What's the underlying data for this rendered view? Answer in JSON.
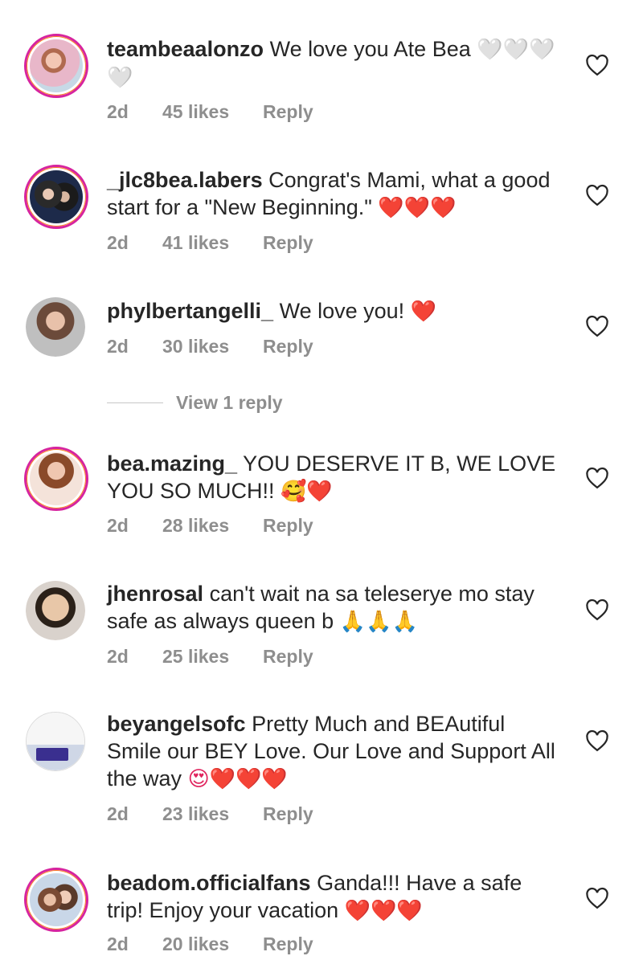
{
  "comments": [
    {
      "username": "teambeaalonzo",
      "text": "We love you Ate Bea",
      "emoji": "🤍🤍🤍🤍",
      "time": "2d",
      "likes": "45 likes",
      "reply": "Reply"
    },
    {
      "username": "_jlc8bea.labers",
      "text": "Congrat's Mami, what a good start for a \"New Beginning.\"",
      "emoji": "❤️❤️❤️",
      "time": "2d",
      "likes": "41 likes",
      "reply": "Reply"
    },
    {
      "username": "phylbertangelli_",
      "text": "We love you!",
      "emoji": "❤️",
      "time": "2d",
      "likes": "30 likes",
      "reply": "Reply"
    },
    {
      "username": "bea.mazing_",
      "text": "YOU DESERVE IT B, WE LOVE YOU SO MUCH!!",
      "emoji": "🥰❤️",
      "time": "2d",
      "likes": "28 likes",
      "reply": "Reply"
    },
    {
      "username": "jhenrosal",
      "text": "can't wait na sa teleserye mo stay safe as always  queen b",
      "emoji": "🙏🙏🙏",
      "time": "2d",
      "likes": "25 likes",
      "reply": "Reply"
    },
    {
      "username": "beyangelsofc",
      "text": "Pretty Much and BEAutiful Smile our BEY Love. Our Love and Support All the way",
      "emoji": "😍❤️❤️❤️",
      "time": "2d",
      "likes": "23 likes",
      "reply": "Reply"
    },
    {
      "username": "beadom.officialfans",
      "text": "Ganda!!! Have a safe trip! Enjoy your vacation",
      "emoji": "❤️❤️❤️",
      "time": "2d",
      "likes": "20 likes",
      "reply": "Reply"
    }
  ],
  "view_replies": {
    "label": "View 1 reply"
  },
  "icons": {
    "like": "heart-outline-icon"
  },
  "colors": {
    "meta_text": "#8e8e8e",
    "story_ring": "#d6249f",
    "heart_red": "#e0245e"
  }
}
